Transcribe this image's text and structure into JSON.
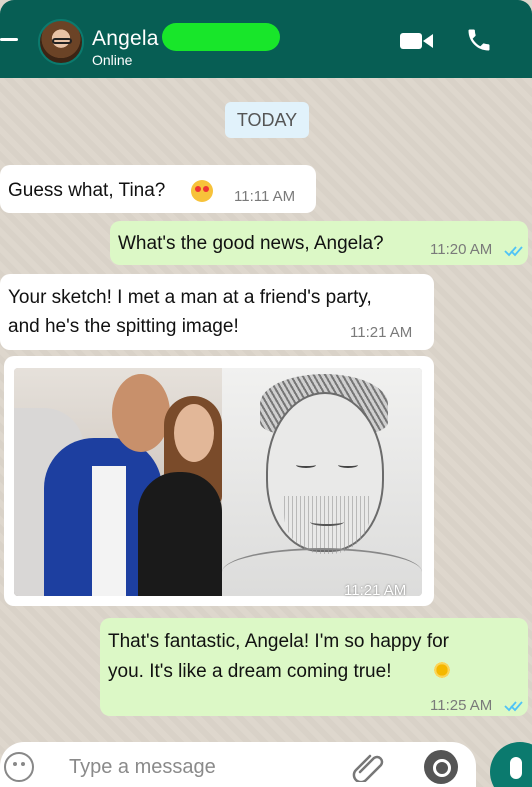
{
  "header": {
    "contact_name": "Angela",
    "status": "Online",
    "video_icon": "video-call-icon",
    "phone_icon": "phone-call-icon",
    "colors": {
      "header_bg": "#075e54",
      "redaction": "#18e62a"
    }
  },
  "chat": {
    "date_chip": "TODAY",
    "messages": [
      {
        "direction": "incoming",
        "text": "Guess what, Tina?",
        "emoji": "heart-eyes-emoji",
        "time": "11:11 AM"
      },
      {
        "direction": "outgoing",
        "text": "What's the good news, Angela?",
        "time": "11:20 AM",
        "read_ticks": "double-blue-check-icon"
      },
      {
        "direction": "incoming",
        "text_line1": "Your sketch! I met a man at a friend's party,",
        "text_line2": "and he's the spitting image!",
        "time": "11:21 AM"
      },
      {
        "direction": "incoming",
        "type": "image",
        "time": "11:21 AM"
      },
      {
        "direction": "outgoing",
        "text_line1": "That's fantastic, Angela! I'm so happy for",
        "text_line2": "you. It's like a dream coming true!",
        "emoji": "sun-emoji",
        "time": "11:25 AM",
        "read_ticks": "double-blue-check-icon"
      }
    ],
    "colors": {
      "incoming_bubble": "#ffffff",
      "outgoing_bubble": "#dcf8c6",
      "wallpaper": "#ddd6cc"
    }
  },
  "composer": {
    "placeholder": "Type a message",
    "icons": [
      "emoji-icon",
      "attach-icon",
      "camera-icon",
      "microphone-icon"
    ]
  }
}
